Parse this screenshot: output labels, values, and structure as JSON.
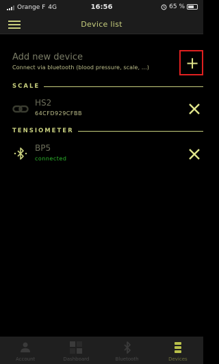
{
  "status_bar": {
    "carrier": "Orange F",
    "network": "4G",
    "time": "16:56",
    "battery_text": "65 %",
    "battery_level": 0.65
  },
  "nav": {
    "title": "Device list"
  },
  "add_device": {
    "title": "Add new device",
    "subtitle": "Connect via bluetooth (blood pressure, scale, ...)",
    "icon": "plus-icon"
  },
  "sections": [
    {
      "label": "SCALE",
      "devices": [
        {
          "name": "HS2",
          "detail": "64CFD929CFBB",
          "icon": "link-icon"
        }
      ]
    },
    {
      "label": "TENSIOMETER",
      "devices": [
        {
          "name": "BP5",
          "detail": "connected",
          "icon": "bluetooth-icon"
        }
      ]
    }
  ],
  "tabs": [
    {
      "label": "Account",
      "icon": "person-icon"
    },
    {
      "label": "Dashboard",
      "icon": "dashboard-grid-icon"
    },
    {
      "label": "Bluetooth",
      "icon": "bluetooth-icon"
    },
    {
      "label": "Devices",
      "icon": "devices-stack-icon",
      "active": true
    }
  ],
  "colors": {
    "accent": "#c8cf7e",
    "connected": "#2db82d",
    "highlight_box": "#e02020",
    "background": "#000000"
  }
}
